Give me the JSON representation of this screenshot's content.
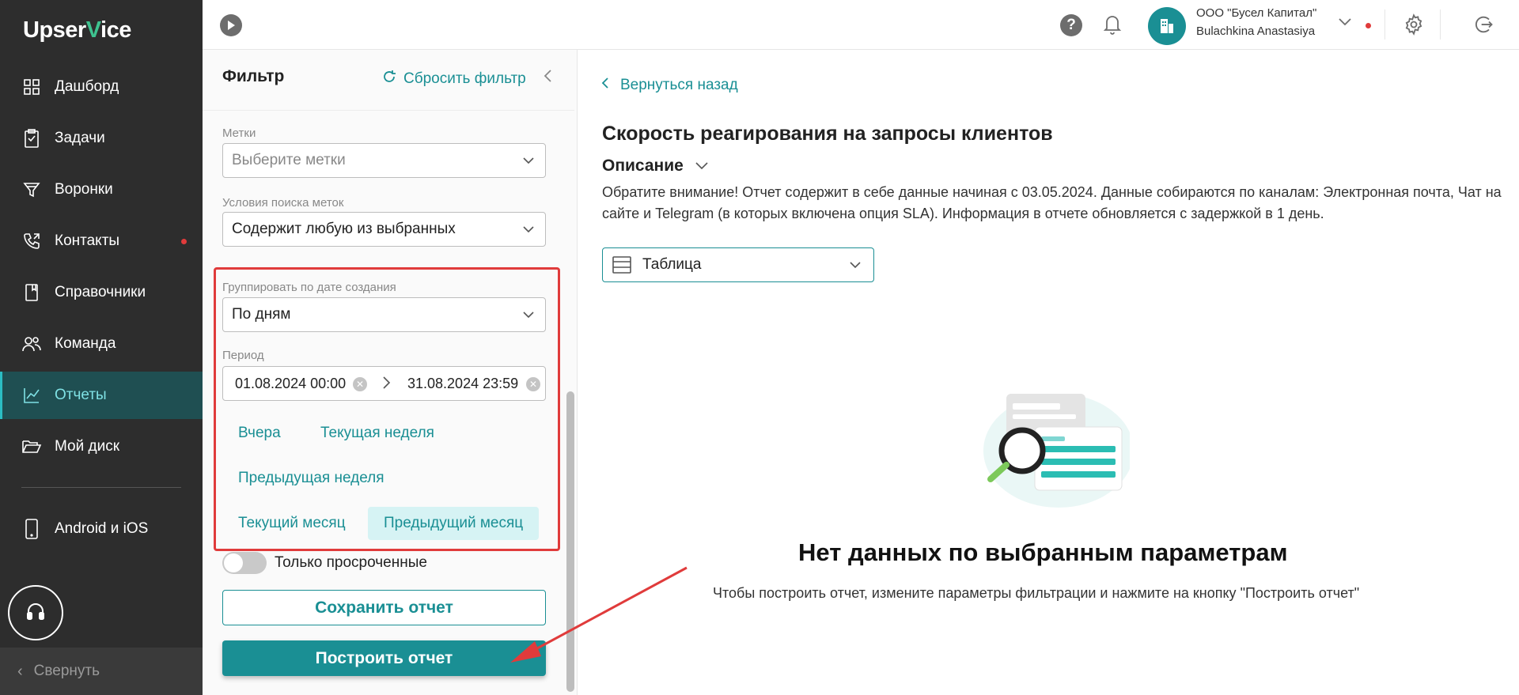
{
  "app": {
    "logo_prefix": "Upser",
    "logo_v": "V",
    "logo_suffix": "ice"
  },
  "sidebar": {
    "items": [
      {
        "label": "Дашборд",
        "icon": "dashboard-icon"
      },
      {
        "label": "Задачи",
        "icon": "tasks-icon"
      },
      {
        "label": "Воронки",
        "icon": "funnel-icon"
      },
      {
        "label": "Контакты",
        "icon": "contacts-icon",
        "badge": true
      },
      {
        "label": "Справочники",
        "icon": "book-icon"
      },
      {
        "label": "Команда",
        "icon": "team-icon"
      },
      {
        "label": "Отчеты",
        "icon": "chart-icon",
        "active": true
      },
      {
        "label": "Мой диск",
        "icon": "folder-icon"
      },
      {
        "label": "Android и iOS",
        "icon": "phone-icon"
      }
    ],
    "collapse_label": "Свернуть"
  },
  "header": {
    "org_name": "ООО \"Бусел Капитал\"",
    "user_name": "Bulachkina Anastasiya",
    "help_label": "?"
  },
  "filter": {
    "title": "Фильтр",
    "reset_label": "Сбросить фильтр",
    "tags_label": "Метки",
    "tags_placeholder": "Выберите метки",
    "tag_cond_label": "Условия поиска меток",
    "tag_cond_value": "Содержит любую из выбранных",
    "group_label": "Группировать по дате создания",
    "group_value": "По дням",
    "period_label": "Период",
    "period_from": "01.08.2024 00:00",
    "period_to": "31.08.2024 23:59",
    "quick": {
      "yesterday": "Вчера",
      "current_week": "Текущая неделя",
      "previous_week": "Предыдущая неделя",
      "current_month": "Текущий месяц",
      "previous_month": "Предыдущий месяц"
    },
    "overdue_only_label": "Только просроченные",
    "save_label": "Сохранить отчет",
    "build_label": "Построить отчет"
  },
  "report": {
    "back_label": "Вернуться назад",
    "title": "Скорость реагирования на запросы клиентов",
    "description_toggle": "Описание",
    "description": "Обратите внимание! Отчет содержит в себе данные начиная с 03.05.2024. Данные собираются по каналам: Электронная почта, Чат на сайте и Telegram (в которых включена опция SLA). Информация в отчете обновляется с задержкой в 1 день.",
    "view_value": "Таблица",
    "empty_title": "Нет данных по выбранным параметрам",
    "empty_subtitle": "Чтобы построить отчет, измените параметры фильтрации и нажмите на кнопку \"Построить отчет\""
  },
  "colors": {
    "accent": "#1a8f94",
    "sidebar_bg": "#2d2d2d",
    "highlight": "#e03b3b",
    "brand_green": "#3ec28f"
  }
}
